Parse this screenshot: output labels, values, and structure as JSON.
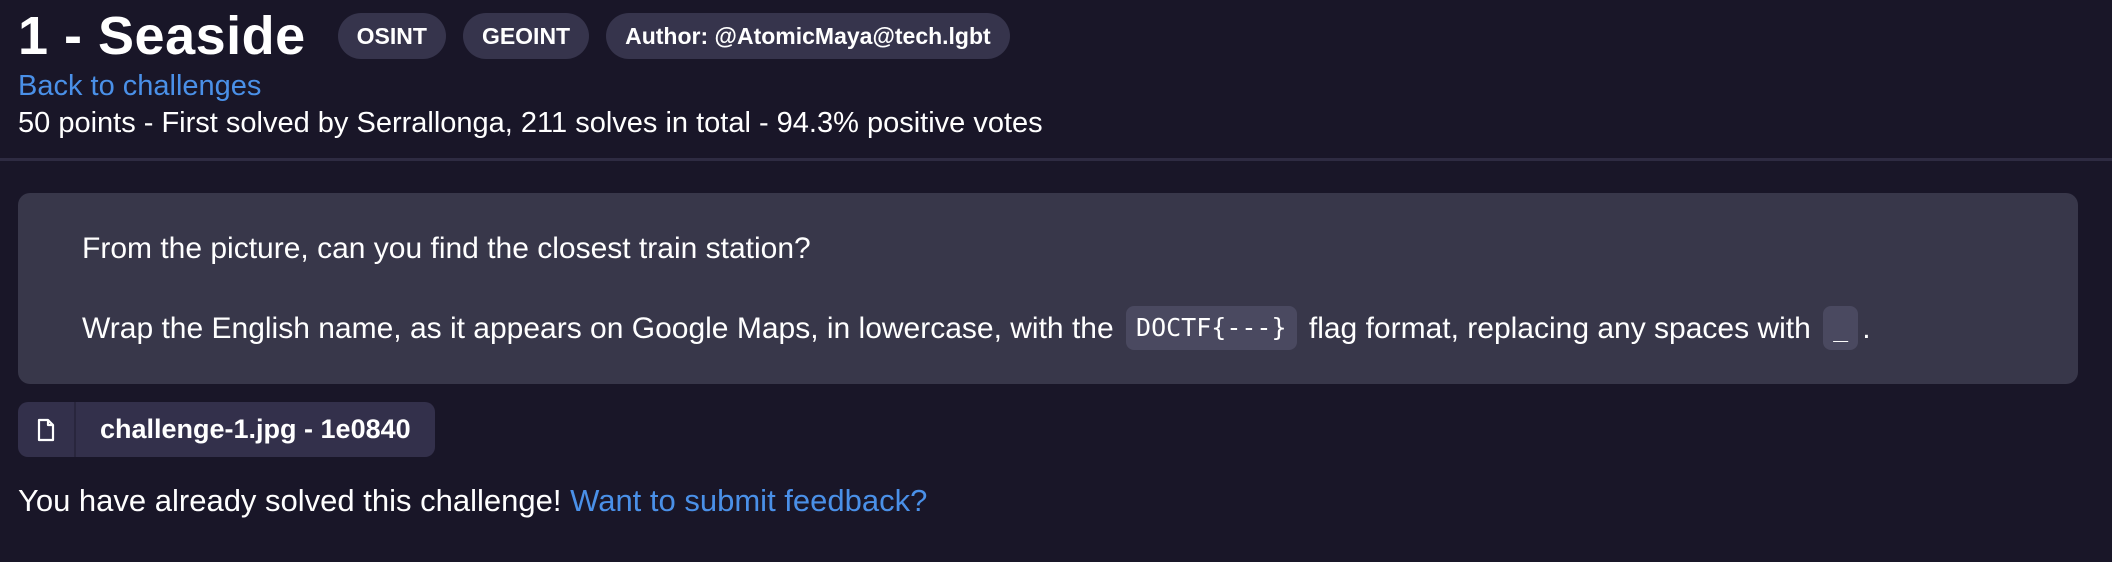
{
  "challenge": {
    "title": "1 - Seaside",
    "tags": [
      "OSINT",
      "GEOINT",
      "Author: @AtomicMaya@tech.lgbt"
    ],
    "back_link": "Back to challenges",
    "stats": "50 points - First solved by Serrallonga, 211 solves in total - 94.3% positive votes"
  },
  "description": {
    "line1": "From the picture, can you find the closest train station?",
    "line2_part1": "Wrap the English name, as it appears on Google Maps, in lowercase, with the",
    "flag_format_code": "DOCTF{---}",
    "line2_part2": "flag format, replacing any spaces with",
    "space_code": "_",
    "line2_part3": "."
  },
  "attachment": {
    "icon": "file-icon",
    "label": "challenge-1.jpg - 1e0840"
  },
  "status": {
    "solved_text": "You have already solved this challenge!",
    "feedback_link": "Want to submit feedback?"
  },
  "colors": {
    "background": "#191628",
    "tag_background": "#36344c",
    "box_background": "#38374a",
    "link": "#4a90e8"
  }
}
